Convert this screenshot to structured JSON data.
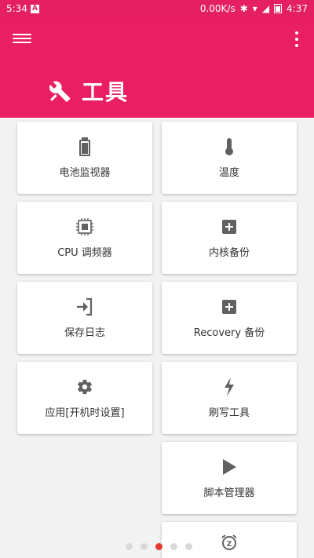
{
  "status_bar": {
    "left_text": "5:34",
    "speed": "0.00K/s",
    "time": "4:37"
  },
  "header": {
    "title": "工具"
  },
  "tools": [
    {
      "label": "电池监视器",
      "icon": "battery-icon"
    },
    {
      "label": "温度",
      "icon": "thermometer-icon"
    },
    {
      "label": "CPU 调频器",
      "icon": "cpu-chip-icon"
    },
    {
      "label": "内核备份",
      "icon": "add-box-icon"
    },
    {
      "label": "保存日志",
      "icon": "login-arrow-icon"
    },
    {
      "label": "Recovery 备份",
      "icon": "add-box-icon"
    },
    {
      "label": "应用[开机时设置]",
      "icon": "gear-icon"
    },
    {
      "label": "刷写工具",
      "icon": "flash-icon"
    },
    {
      "label": "脚本管理器",
      "icon": "play-icon"
    },
    {
      "label": "",
      "icon": "alarm-snooze-icon"
    }
  ],
  "page_indicator": {
    "count": 5,
    "active_index": 2
  },
  "colors": {
    "primary": "#e91e63",
    "indicator_active": "#e53935"
  }
}
